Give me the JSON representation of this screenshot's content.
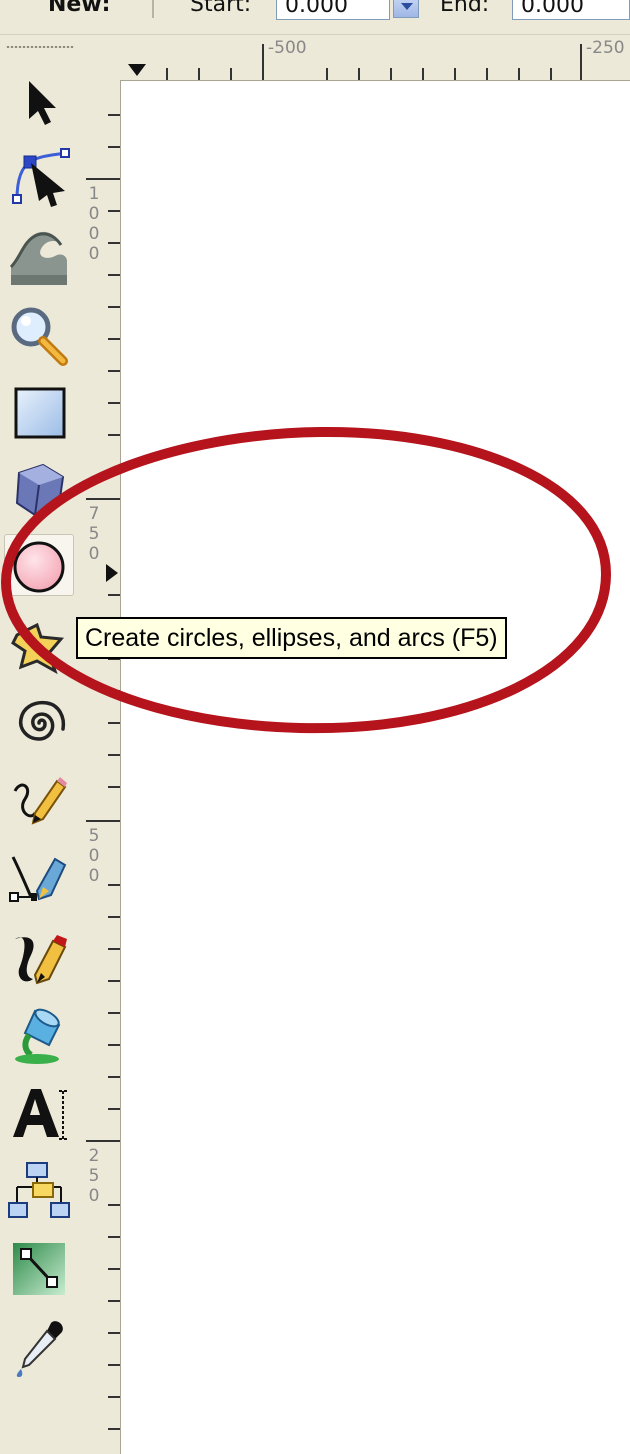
{
  "topbar": {
    "new_label": "New:",
    "start_label": "Start:",
    "start_value": "0.000",
    "end_label": "End:",
    "end_value": "0.000"
  },
  "hruler": {
    "labels": [
      "-500",
      "-250"
    ]
  },
  "vruler": {
    "labels": [
      "1000",
      "750",
      "500",
      "250"
    ]
  },
  "tools": [
    {
      "name": "selector-tool",
      "icon": "arrow-pointer-icon"
    },
    {
      "name": "node-tool",
      "icon": "node-edit-icon"
    },
    {
      "name": "tweak-tool",
      "icon": "wave-tweak-icon"
    },
    {
      "name": "zoom-tool",
      "icon": "magnifier-icon"
    },
    {
      "name": "rectangle-tool",
      "icon": "rectangle-icon"
    },
    {
      "name": "3d-box-tool",
      "icon": "3d-box-icon"
    },
    {
      "name": "ellipse-tool",
      "icon": "circle-icon",
      "active": true
    },
    {
      "name": "star-tool",
      "icon": "star-icon"
    },
    {
      "name": "spiral-tool",
      "icon": "spiral-icon"
    },
    {
      "name": "pencil-tool",
      "icon": "pencil-icon"
    },
    {
      "name": "pen-tool",
      "icon": "bezier-pen-icon"
    },
    {
      "name": "calligraphy-tool",
      "icon": "calligraphy-pen-icon"
    },
    {
      "name": "paint-bucket-tool",
      "icon": "paint-bucket-icon"
    },
    {
      "name": "text-tool",
      "icon": "text-a-icon"
    },
    {
      "name": "connector-tool",
      "icon": "diagram-connector-icon"
    },
    {
      "name": "gradient-tool",
      "icon": "gradient-icon"
    },
    {
      "name": "dropper-tool",
      "icon": "eyedropper-icon"
    }
  ],
  "tooltip": {
    "text": "Create circles, ellipses, and arcs (F5)"
  },
  "colors": {
    "annotation_ellipse": "#b5141c",
    "tooltip_bg": "#ffffe1",
    "panel_bg": "#ece9d8"
  }
}
